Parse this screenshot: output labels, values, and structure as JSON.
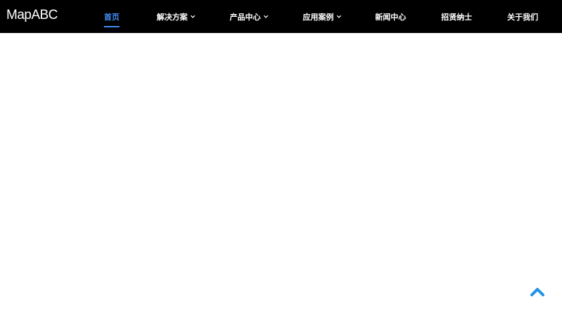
{
  "header": {
    "logo": "MapABC",
    "nav": [
      {
        "label": "首页",
        "active": true,
        "dropdown": false
      },
      {
        "label": "解决方案",
        "active": false,
        "dropdown": true
      },
      {
        "label": "产品中心",
        "active": false,
        "dropdown": true
      },
      {
        "label": "应用案例",
        "active": false,
        "dropdown": true
      },
      {
        "label": "新闻中心",
        "active": false,
        "dropdown": false
      },
      {
        "label": "招贤纳士",
        "active": false,
        "dropdown": false
      },
      {
        "label": "关于我们",
        "active": false,
        "dropdown": false
      }
    ]
  },
  "colors": {
    "header_bg": "#000000",
    "accent": "#3f8ff7",
    "back_to_top": "#1e90e8"
  },
  "icons": {
    "dropdown": "chevron-down-icon",
    "back_to_top": "chevron-up-icon"
  }
}
